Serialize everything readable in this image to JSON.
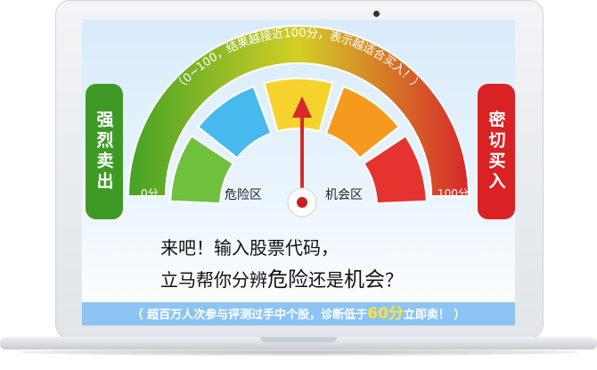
{
  "gauge": {
    "arc_text": "（0~100，结果越接近100分，表示越适合买入！）",
    "min_label": "0分",
    "max_label": "100分",
    "danger_label": "危险区",
    "opportunity_label": "机会区",
    "colors": {
      "green": "#44a226",
      "red": "#d7282a",
      "seg1": "#6fc13d",
      "seg2": "#48b9ee",
      "seg3": "#f6d32c",
      "seg4": "#f59a1f",
      "seg5": "#e5342f",
      "needle": "#d62a2a"
    }
  },
  "side_left": {
    "label": "强烈卖出"
  },
  "side_right": {
    "label": "密切买入"
  },
  "cta": {
    "line1": "来吧！输入股票代码，",
    "line2_part1": "立马帮你分辨",
    "line2_hl1": "危险",
    "line2_part2": "还是",
    "line2_hl2": "机会",
    "line2_part3": "？"
  },
  "banner": {
    "text_before": "（ 超百万人次参与评测过手中个股，诊断低于",
    "num": "60分",
    "text_after": "立即卖！ ）"
  }
}
